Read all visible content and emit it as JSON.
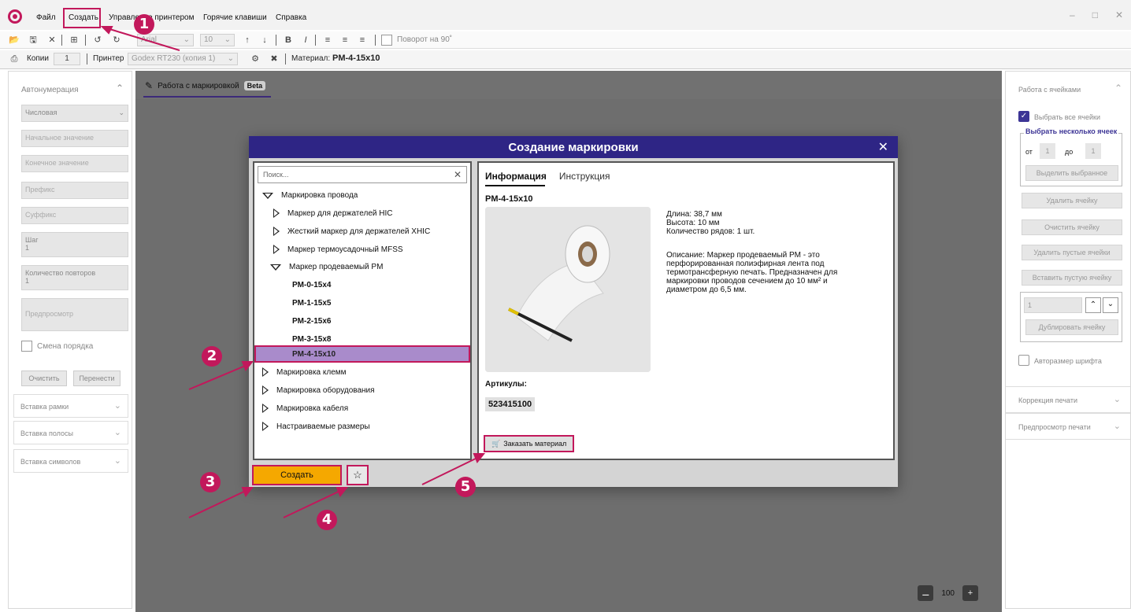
{
  "menu": {
    "file": "Файл",
    "create": "Создать",
    "printer_mgmt": "Управление принтером",
    "hotkeys": "Горячие клавиши",
    "help": "Справка"
  },
  "toolbar": {
    "font": "Arial",
    "size": "10",
    "rotate_label": "Поворот на 90˚"
  },
  "toolbar2": {
    "copies_label": "Копии",
    "copies_value": "1",
    "printer_label": "Принтер",
    "printer_value": "Godex RT230 (копия 1)",
    "material_label": "Материал:",
    "material_value": "PM-4-15x10"
  },
  "left_panel": {
    "title": "Автонумерация",
    "type": "Числовая",
    "start": "Начальное значение",
    "end": "Конечное значение",
    "prefix": "Префикс",
    "suffix": "Суффикс",
    "step_label": "Шаг",
    "step_value": "1",
    "repeat_label": "Количество повторов",
    "repeat_value": "1",
    "preview": "Предпросмотр",
    "order_swap": "Смена порядка",
    "clear": "Очистить",
    "transfer": "Перенести",
    "sections": [
      "Вставка рамки",
      "Вставка полосы",
      "Вставка символов"
    ]
  },
  "canvas": {
    "tab_label": "Работа с маркировкой",
    "beta": "Beta",
    "zoom": "100"
  },
  "right_panel": {
    "title": "Работа с ячейками",
    "select_all": "Выбрать все ячейки",
    "select_multi": "Выбрать несколько ячеек",
    "from": "от",
    "from_val": "1",
    "to": "до",
    "to_val": "1",
    "select_chosen": "Выделить выбранное",
    "delete_cell": "Удалить ячейку",
    "clear_cell": "Очистить ячейку",
    "delete_empty": "Удалить пустые ячейки",
    "insert_empty": "Вставить пустую ячейку",
    "dup_value": "1",
    "duplicate": "Дублировать ячейку",
    "autosize": "Авторазмер шрифта",
    "sections": [
      "Коррекция печати",
      "Предпросмотр печати"
    ]
  },
  "dialog": {
    "title": "Создание маркировки",
    "search_placeholder": "Поиск...",
    "tree": {
      "wire": "Маркировка провода",
      "hic": "Маркер для держателей HIC",
      "xhic": "Жесткий маркер для держателей XHIC",
      "mfss": "Маркер термоусадочный MFSS",
      "pm": "Маркер продеваемый PM",
      "leaves": [
        "PM-0-15x4",
        "PM-1-15x5",
        "PM-2-15x6",
        "PM-3-15x8",
        "PM-4-15x10"
      ],
      "terminals": "Маркировка клемм",
      "equipment": "Маркировка оборудования",
      "cable": "Маркировка кабеля",
      "custom": "Настраиваемые размеры"
    },
    "tabs": [
      "Информация",
      "Инструкция"
    ],
    "product_code": "PM-4-15x10",
    "length": "Длина: 38,7 мм",
    "height": "Высота: 10 мм",
    "rows": "Количество рядов: 1 шт.",
    "description": "Описание: Маркер продеваемый PM - это перфорированная полиэфирная лента под термотрансферную печать. Предназначен для маркировки проводов сечением до 10 мм² и диаметром до 6,5 мм.",
    "articles_label": "Артикулы:",
    "article": "523415100",
    "order_btn": "Заказать материал",
    "create_btn": "Создать"
  },
  "annotations": [
    "1",
    "2",
    "3",
    "4",
    "5"
  ],
  "colors": {
    "accent": "#c2185b",
    "dialog_header": "#2e2585",
    "selected": "#a98bcb",
    "create_btn": "#f5a800"
  }
}
